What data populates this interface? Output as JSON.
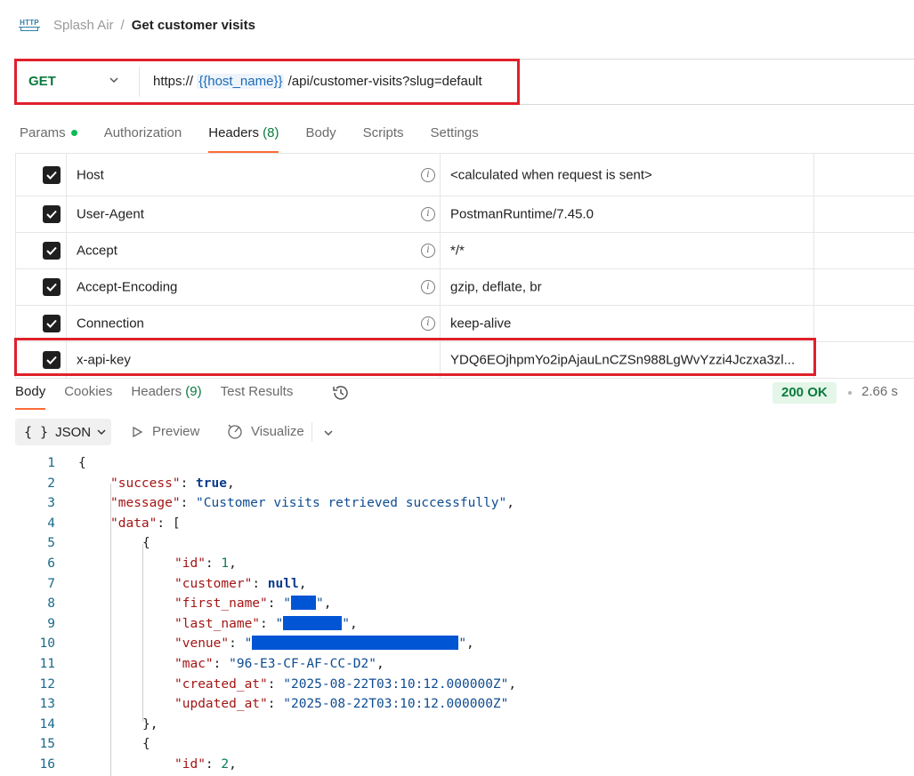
{
  "breadcrumb": {
    "icon": "http-icon",
    "workspace": "Splash Air",
    "separator": "/",
    "title": "Get customer visits"
  },
  "request": {
    "method": "GET",
    "url_prefix": "https://",
    "url_variable": "{{host_name}}",
    "url_path": "/api/customer-visits?slug=default"
  },
  "request_tabs": {
    "params": "Params",
    "authorization": "Authorization",
    "headers": "Headers",
    "headers_count": "(8)",
    "body": "Body",
    "scripts": "Scripts",
    "settings": "Settings"
  },
  "headers": [
    {
      "key": "Host",
      "value": "<calculated when request is sent>",
      "checked": true,
      "info": true
    },
    {
      "key": "User-Agent",
      "value": "PostmanRuntime/7.45.0",
      "checked": true,
      "info": true
    },
    {
      "key": "Accept",
      "value": "*/*",
      "checked": true,
      "info": true
    },
    {
      "key": "Accept-Encoding",
      "value": "gzip, deflate, br",
      "checked": true,
      "info": true
    },
    {
      "key": "Connection",
      "value": "keep-alive",
      "checked": true,
      "info": true
    },
    {
      "key": "x-api-key",
      "value": "YDQ6EOjhpmYo2ipAjauLnCZSn988LgWvYzzi4Jczxa3zl...",
      "checked": true,
      "info": false
    }
  ],
  "response_tabs": {
    "body": "Body",
    "cookies": "Cookies",
    "headers": "Headers",
    "headers_count": "(9)",
    "test_results": "Test Results"
  },
  "response_status": {
    "status": "200 OK",
    "time": "2.66 s"
  },
  "response_toolbar": {
    "format_icon": "{ }",
    "format": "JSON",
    "preview": "Preview",
    "visualize": "Visualize"
  },
  "code_lines": [
    "1",
    "2",
    "3",
    "4",
    "5",
    "6",
    "7",
    "8",
    "9",
    "10",
    "11",
    "12",
    "13",
    "14",
    "15",
    "16"
  ],
  "json_body": {
    "open_brace": "{",
    "success_key": "\"success\"",
    "success_val": "true",
    "message_key": "\"message\"",
    "message_val": "\"Customer visits retrieved successfully\"",
    "data_key": "\"data\"",
    "data_open": "[",
    "item1": {
      "id_key": "\"id\"",
      "id_val": "1",
      "customer_key": "\"customer\"",
      "customer_val": "null",
      "first_name_key": "\"first_name\"",
      "last_name_key": "\"last_name\"",
      "venue_key": "\"venue\"",
      "mac_key": "\"mac\"",
      "mac_val": "\"96-E3-CF-AF-CC-D2\"",
      "created_at_key": "\"created_at\"",
      "created_at_val": "\"2025-08-22T03:10:12.000000Z\"",
      "updated_at_key": "\"updated_at\"",
      "updated_at_val": "\"2025-08-22T03:10:12.000000Z\""
    },
    "item2": {
      "id_key": "\"id\"",
      "id_val": "2"
    }
  },
  "colors": {
    "accent": "#ff6c37",
    "method": "#0b7a3e",
    "highlight": "#e0202a",
    "redaction": "#0055d4"
  }
}
